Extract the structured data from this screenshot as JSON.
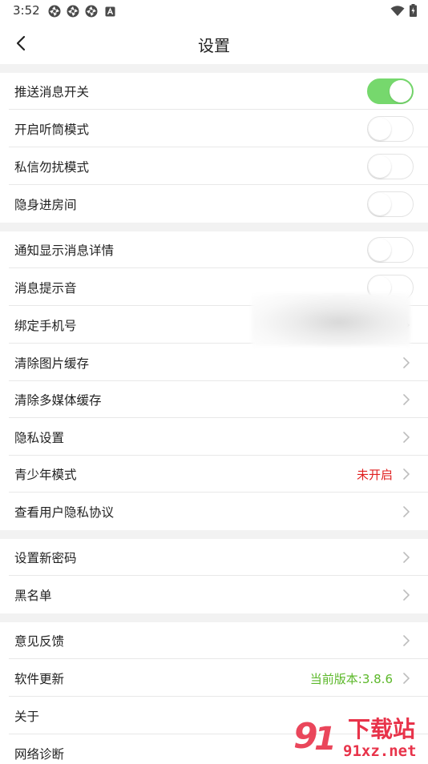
{
  "status_bar": {
    "time": "3:52",
    "icons": [
      "app-notification-icon",
      "app-notification-icon",
      "app-notification-icon",
      "a-notification-icon",
      "wifi-icon",
      "battery-icon"
    ]
  },
  "header": {
    "title": "设置"
  },
  "sections": [
    {
      "items": [
        {
          "label": "推送消息开关",
          "control": "toggle",
          "on": true
        },
        {
          "label": "开启听筒模式",
          "control": "toggle",
          "on": false
        },
        {
          "label": "私信勿扰模式",
          "control": "toggle",
          "on": false
        },
        {
          "label": "隐身进房间",
          "control": "toggle",
          "on": false
        }
      ]
    },
    {
      "items": [
        {
          "label": "通知显示消息详情",
          "control": "toggle",
          "on": false
        },
        {
          "label": "消息提示音",
          "control": "toggle",
          "on": false
        },
        {
          "label": "绑定手机号",
          "control": "chevron"
        },
        {
          "label": "清除图片缓存",
          "control": "chevron"
        },
        {
          "label": "清除多媒体缓存",
          "control": "chevron"
        },
        {
          "label": "隐私设置",
          "control": "chevron"
        },
        {
          "label": "青少年模式",
          "control": "chevron",
          "value": "未开启",
          "value_color": "#e02020"
        },
        {
          "label": "查看用户隐私协议",
          "control": "chevron"
        }
      ]
    },
    {
      "items": [
        {
          "label": "设置新密码",
          "control": "chevron"
        },
        {
          "label": "黑名单",
          "control": "chevron"
        }
      ]
    },
    {
      "items": [
        {
          "label": "意见反馈",
          "control": "chevron"
        },
        {
          "label": "软件更新",
          "control": "chevron",
          "value": "当前版本:3.8.6",
          "value_color": "#5cb82a"
        },
        {
          "label": "关于",
          "control": "none"
        },
        {
          "label": "网络诊断",
          "control": "none"
        }
      ]
    }
  ],
  "watermark": {
    "logo_text": "下载站",
    "logo_sub": "91xz.net",
    "color": "#e8334a"
  },
  "colors": {
    "toggle_on": "#76d86d",
    "section_gap": "#f2f2f2",
    "divider": "#e8e8e8",
    "chevron": "#bdbdbd"
  }
}
